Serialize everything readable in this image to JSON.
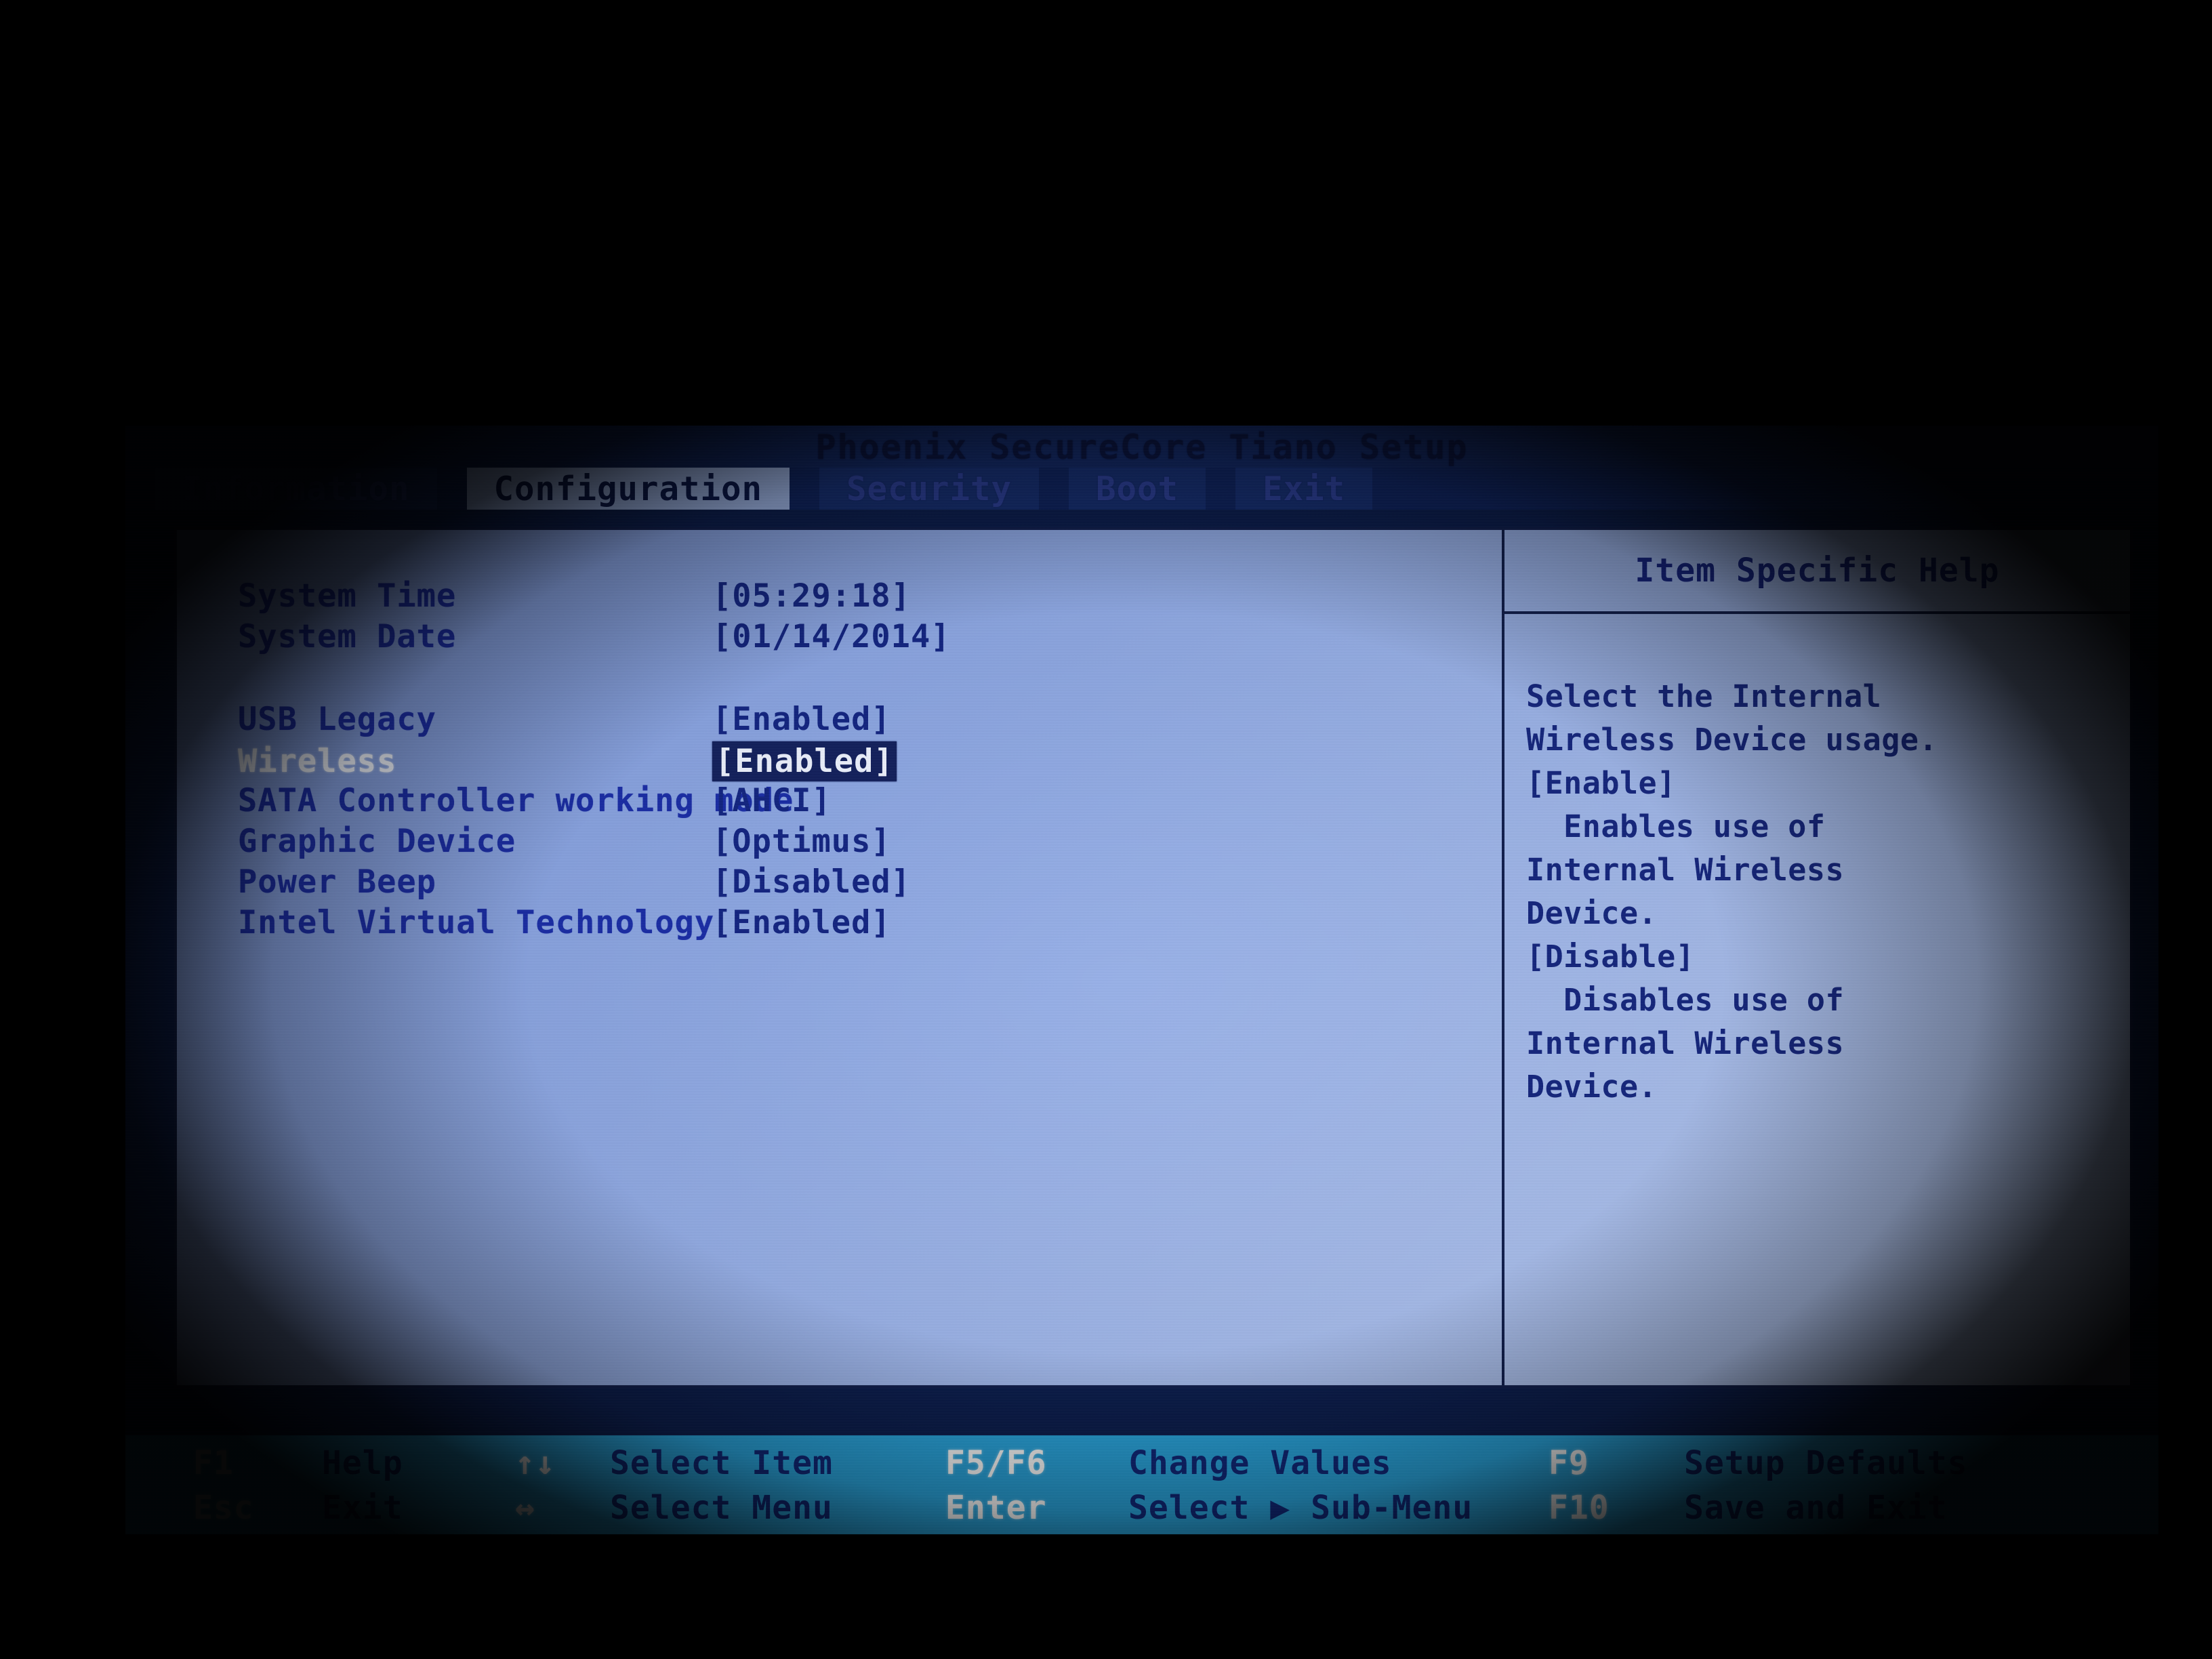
{
  "window": {
    "title": "Phoenix SecureCore Tiano Setup"
  },
  "tabs": [
    {
      "label": "Information",
      "selected": false
    },
    {
      "label": "Configuration",
      "selected": true
    },
    {
      "label": "Security",
      "selected": false
    },
    {
      "label": "Boot",
      "selected": false
    },
    {
      "label": "Exit",
      "selected": false
    }
  ],
  "settings": [
    {
      "label": "System Time",
      "value": "[05:29:18]",
      "selected": false,
      "highlight": false
    },
    {
      "label": "System Date",
      "value": "[01/14/2014]",
      "selected": false,
      "highlight": false
    },
    {
      "label": "USB Legacy",
      "value": "[Enabled]",
      "selected": false,
      "highlight": false
    },
    {
      "label": "Wireless",
      "value": "[Enabled]",
      "selected": true,
      "highlight": true
    },
    {
      "label": "SATA Controller working mode",
      "value": "[AHCI]",
      "selected": false,
      "highlight": false
    },
    {
      "label": "Graphic Device",
      "value": "[Optimus]",
      "selected": false,
      "highlight": false
    },
    {
      "label": "Power Beep",
      "value": "[Disabled]",
      "selected": false,
      "highlight": false
    },
    {
      "label": "Intel Virtual Technology",
      "value": "[Enabled]",
      "selected": false,
      "highlight": false
    }
  ],
  "help": {
    "title": "Item Specific Help",
    "lines": [
      "Select the Internal",
      "Wireless Device usage.",
      "[Enable]",
      "  Enables use of",
      "Internal Wireless",
      "Device.",
      "[Disable]",
      "  Disables use of",
      "Internal Wireless",
      "Device."
    ]
  },
  "footer": {
    "row1": [
      {
        "key": "F1",
        "desc": "Help"
      },
      {
        "key": "↑↓",
        "desc": "Select Item"
      },
      {
        "key": "F5/F6",
        "desc": "Change Values"
      },
      {
        "key": "F9",
        "desc": "Setup Defaults"
      }
    ],
    "row2": [
      {
        "key": "Esc",
        "desc": "Exit"
      },
      {
        "key": "↔",
        "desc": "Select Menu"
      },
      {
        "key": "Enter",
        "desc": "Select ▶ Sub-Menu"
      },
      {
        "key": "F10",
        "desc": "Save and Exit"
      }
    ]
  },
  "colors": {
    "screen_background": "#8fa9e4",
    "title_background": "#132a68",
    "tab_selected_background": "#9fb6e8",
    "text_primary": "#1b2ea8",
    "text_selected": "#f2f6ff",
    "highlight_background": "#14225e",
    "footer_background": "#2aa7e0",
    "footer_key": "#ffffff",
    "footer_desc": "#10287a",
    "border": "#12204f"
  }
}
